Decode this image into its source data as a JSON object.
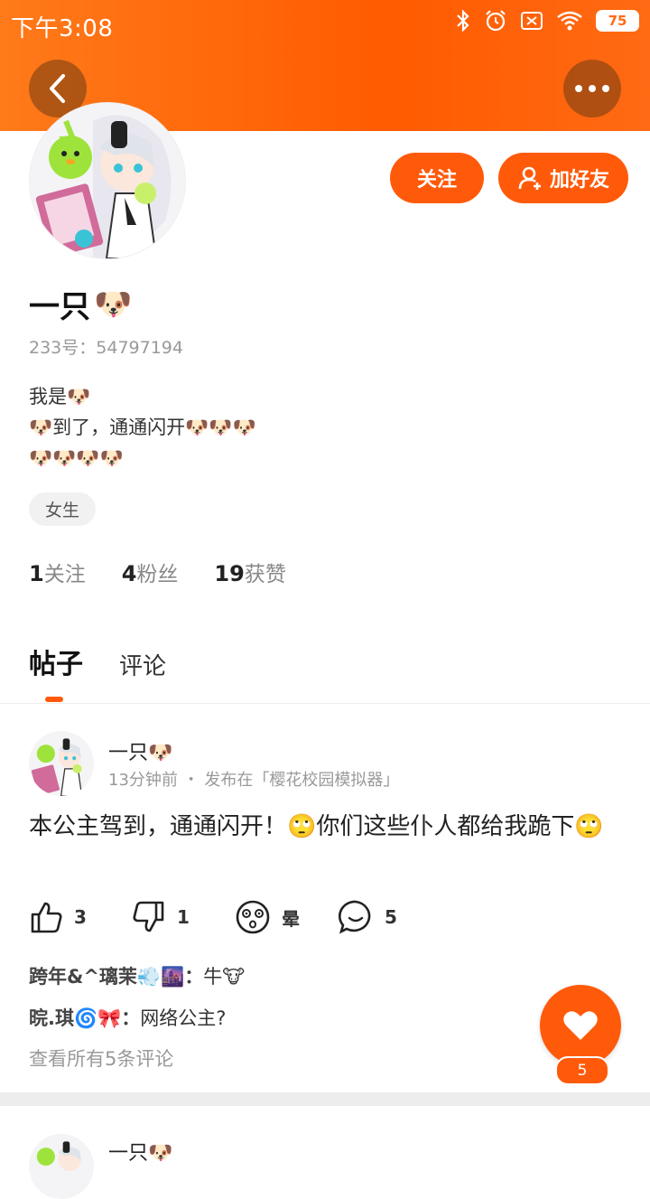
{
  "status_bar": {
    "time": "下午3:08",
    "battery": "75"
  },
  "colors": {
    "accent": "#ff5a0a",
    "header": "#ff6a14"
  },
  "profile": {
    "name": "一只",
    "name_emoji": "🐶",
    "id_label": "233号：54797194",
    "bio_lines": [
      "我是🐶",
      "🐶到了，通通闪开🐶🐶🐶",
      "🐶🐶🐶🐶"
    ],
    "gender_tag": "女生",
    "stats": {
      "following_count": "1",
      "following_label": "关注",
      "fans_count": "4",
      "fans_label": "粉丝",
      "likes_count": "19",
      "likes_label": "获赞"
    }
  },
  "buttons": {
    "follow": "关注",
    "add_friend": "加好友"
  },
  "tabs": {
    "posts": "帖子",
    "comments": "评论"
  },
  "post": {
    "author": "一只🐶",
    "meta": "13分钟前 ・ 发布在「樱花校园模拟器」",
    "text": "本公主驾到，通通闪开！🙄你们这些仆人都给我跪下🙄",
    "actions": {
      "like": "3",
      "dislike": "1",
      "dizzy": "晕",
      "comment": "5"
    },
    "comments": [
      {
        "user": "跨年&^璃茉💨🌆",
        "text": "牛🐮"
      },
      {
        "user": "晥.琪🌀🎀",
        "text": "网络公主?"
      }
    ],
    "view_all": "查看所有5条评论"
  },
  "post2": {
    "author": "一只🐶"
  },
  "fab": {
    "like_count": "5"
  }
}
